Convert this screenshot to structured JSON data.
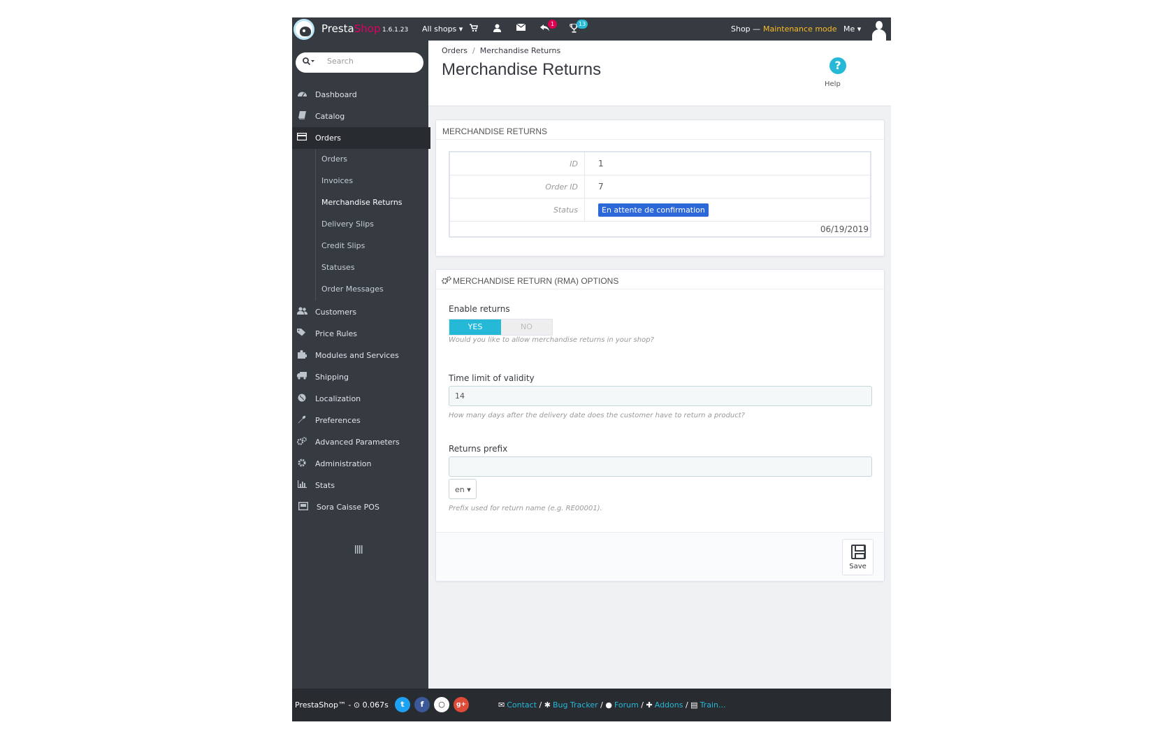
{
  "header": {
    "brand_presta": "Presta",
    "brand_shop": "Shop",
    "version": "1.6.1.23",
    "all_shops": "All shops ▾",
    "cart_icon": "cart-icon",
    "customer_icon": "user-icon",
    "message_icon": "envelope-icon",
    "returns_icon": "reply-icon",
    "returns_badge": "1",
    "trophy_icon": "trophy-icon",
    "trophy_badge": "13",
    "shop_label": "Shop —",
    "maintenance": "Maintenance mode",
    "me": "Me ▾",
    "colors": {
      "header_bg": "#363a41",
      "shop_pink": "#df0067",
      "maintenance": "#fbbb22",
      "badge_red": "#e0004f",
      "badge_blue": "#25b9d7"
    }
  },
  "sidebar": {
    "search_placeholder": "Search",
    "items": [
      {
        "label": "Dashboard",
        "icon": "dashboard-icon"
      },
      {
        "label": "Catalog",
        "icon": "book-icon"
      },
      {
        "label": "Orders",
        "icon": "credit-card-icon"
      },
      {
        "label": "Customers",
        "icon": "users-icon"
      },
      {
        "label": "Price Rules",
        "icon": "tags-icon"
      },
      {
        "label": "Modules and Services",
        "icon": "puzzle-icon"
      },
      {
        "label": "Shipping",
        "icon": "truck-icon"
      },
      {
        "label": "Localization",
        "icon": "globe-icon"
      },
      {
        "label": "Preferences",
        "icon": "wrench-icon"
      },
      {
        "label": "Advanced Parameters",
        "icon": "cogs-icon"
      },
      {
        "label": "Administration",
        "icon": "cog-icon"
      },
      {
        "label": "Stats",
        "icon": "bar-chart-icon"
      },
      {
        "label": "Sora Caisse POS",
        "icon": "pos-icon"
      }
    ],
    "orders_sub": [
      "Orders",
      "Invoices",
      "Merchandise Returns",
      "Delivery Slips",
      "Credit Slips",
      "Statuses",
      "Order Messages"
    ],
    "collapse_icon": "collapse-icon"
  },
  "toolbar": {
    "breadcrumb_parent": "Orders",
    "breadcrumb_current": "Merchandise Returns",
    "title": "Merchandise Returns",
    "help_label": "Help"
  },
  "returns_panel": {
    "heading": "MERCHANDISE RETURNS",
    "id_label": "ID",
    "id_value": "1",
    "order_id_label": "Order ID",
    "order_id_value": "7",
    "status_label": "Status",
    "status_value": "En attente de confirmation",
    "date": "06/19/2019"
  },
  "options_panel": {
    "heading": "MERCHANDISE RETURN (RMA) OPTIONS",
    "enable_label": "Enable returns",
    "yes": "YES",
    "no": "NO",
    "enable_help": "Would you like to allow merchandise returns in your shop?",
    "time_label": "Time limit of validity",
    "time_value": "14",
    "time_help": "How many days after the delivery date does the customer have to return a product?",
    "prefix_label": "Returns prefix",
    "prefix_value": "",
    "lang": "en ▾",
    "prefix_help": "Prefix used for return name (e.g. RE00001).",
    "save": "Save"
  },
  "footer": {
    "copyright": "PrestaShop™ - ⊙ 0.067s",
    "social": [
      "t",
      "f",
      "○",
      "g+"
    ],
    "links": [
      "Contact",
      "Bug Tracker",
      "Forum",
      "Addons",
      "Train..."
    ]
  }
}
